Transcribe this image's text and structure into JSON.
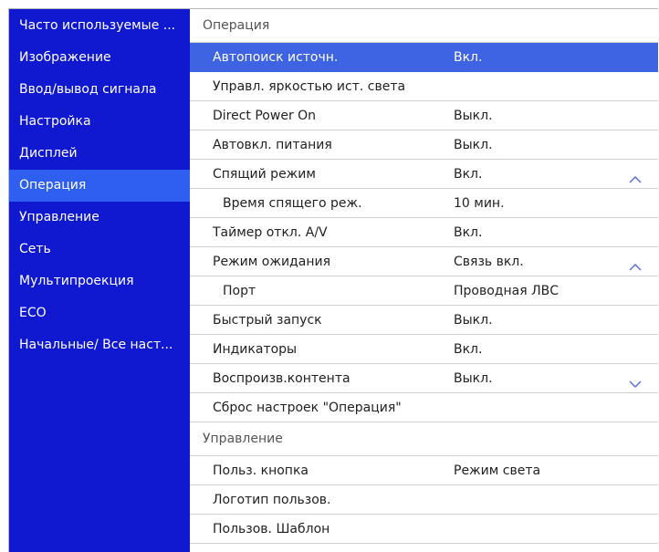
{
  "sidebar": {
    "items": [
      {
        "label": "Часто используемые ...",
        "active": false
      },
      {
        "label": "Изображение",
        "active": false
      },
      {
        "label": "Ввод/вывод сигнала",
        "active": false
      },
      {
        "label": "Настройка",
        "active": false
      },
      {
        "label": "Дисплей",
        "active": false
      },
      {
        "label": "Операция",
        "active": true
      },
      {
        "label": "Управление",
        "active": false
      },
      {
        "label": "Сеть",
        "active": false
      },
      {
        "label": "Мультипроекция",
        "active": false
      },
      {
        "label": "ECO",
        "active": false
      },
      {
        "label": "Начальные/ Все наст...",
        "active": false
      }
    ]
  },
  "main": {
    "section1_title": "Операция",
    "section1_rows": [
      {
        "label": "Автопоиск источн.",
        "value": "Вкл.",
        "chevron": "",
        "sub": false,
        "selected": true
      },
      {
        "label": "Управл. яркостью ист. света",
        "value": "",
        "chevron": "",
        "sub": false,
        "selected": false
      },
      {
        "label": "Direct Power On",
        "value": "Выкл.",
        "chevron": "",
        "sub": false,
        "selected": false
      },
      {
        "label": "Автовкл. питания",
        "value": "Выкл.",
        "chevron": "",
        "sub": false,
        "selected": false
      },
      {
        "label": "Спящий режим",
        "value": "Вкл.",
        "chevron": "chevron-up-icon",
        "sub": false,
        "selected": false
      },
      {
        "label": "Время спящего реж.",
        "value": "10 мин.",
        "chevron": "",
        "sub": true,
        "selected": false
      },
      {
        "label": "Таймер откл. A/V",
        "value": "Вкл.",
        "chevron": "",
        "sub": false,
        "selected": false
      },
      {
        "label": "Режим ожидания",
        "value": "Связь вкл.",
        "chevron": "chevron-up-icon",
        "sub": false,
        "selected": false
      },
      {
        "label": "Порт",
        "value": "Проводная ЛВС",
        "chevron": "",
        "sub": true,
        "selected": false
      },
      {
        "label": "Быстрый запуск",
        "value": "Выкл.",
        "chevron": "",
        "sub": false,
        "selected": false
      },
      {
        "label": "Индикаторы",
        "value": "Вкл.",
        "chevron": "",
        "sub": false,
        "selected": false
      },
      {
        "label": "Воспроизв.контента",
        "value": "Выкл.",
        "chevron": "chevron-down-icon",
        "sub": false,
        "selected": false
      },
      {
        "label": "Сброс настроек \"Операция\"",
        "value": "",
        "chevron": "",
        "sub": false,
        "selected": false
      }
    ],
    "section2_title": "Управление",
    "section2_rows": [
      {
        "label": "Польз. кнопка",
        "value": "Режим света",
        "chevron": "",
        "sub": false,
        "selected": false
      },
      {
        "label": "Логотип пользов.",
        "value": "",
        "chevron": "",
        "sub": false,
        "selected": false
      },
      {
        "label": "Пользов. Шаблон",
        "value": "",
        "chevron": "",
        "sub": false,
        "selected": false
      }
    ]
  },
  "colors": {
    "sidebar_bg": "#1119d0",
    "sidebar_active": "#2f5ff0",
    "row_selected": "#3e63e3"
  }
}
